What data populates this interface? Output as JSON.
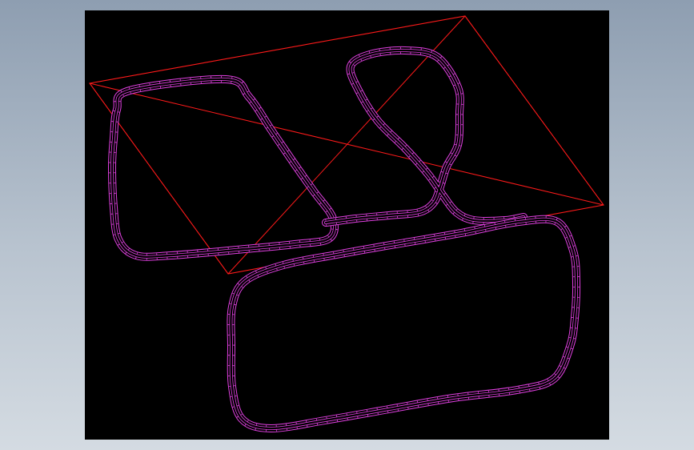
{
  "canvas": {
    "background_color": "#000000",
    "surround_top_color": "#8e9eb1",
    "surround_bottom_color": "#d4dbe2"
  },
  "bounding_frame": {
    "color": "#ff1a1a",
    "diagonals_shown": true
  },
  "wire_paths": {
    "color": "#e040e0",
    "mesh_style": "wireframe-tube",
    "loops": [
      {
        "name": "upper-left-loop"
      },
      {
        "name": "upper-right-hook"
      },
      {
        "name": "lower-rounded-rectangle"
      }
    ]
  }
}
